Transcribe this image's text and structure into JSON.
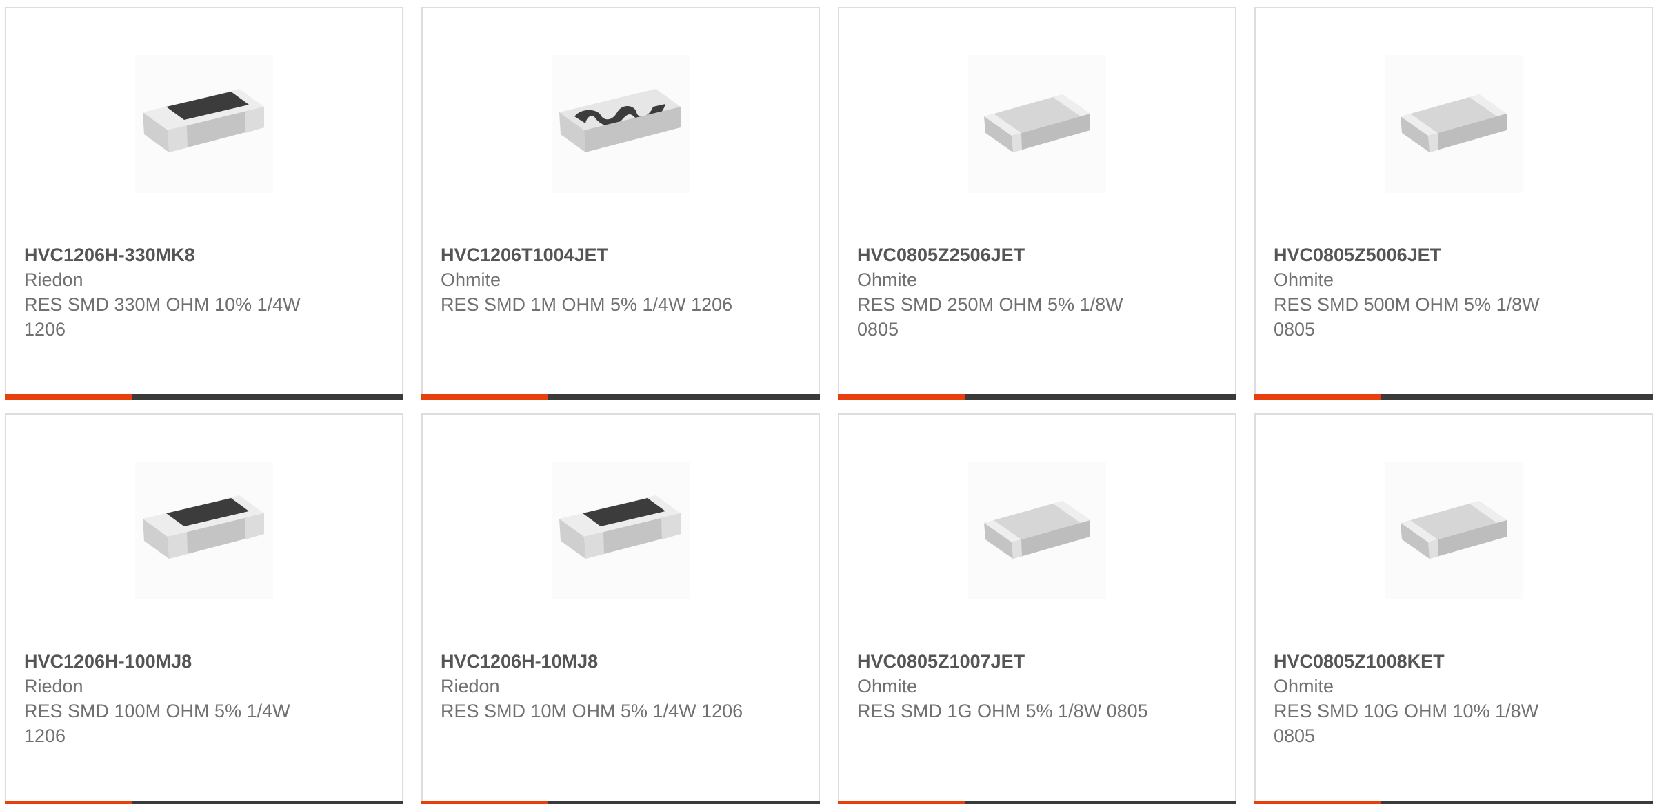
{
  "accent_color": "#e8400c",
  "bar_color": "#3a3a3a",
  "products": [
    {
      "part_number": "HVC1206H-330MK8",
      "manufacturer": "Riedon",
      "description": "RES SMD 330M OHM 10% 1/4W 1206",
      "image": "resistor-1206-dark-top-icon"
    },
    {
      "part_number": "HVC1206T1004JET",
      "manufacturer": "Ohmite",
      "description": "RES SMD 1M OHM 5% 1/4W 1206",
      "image": "resistor-1206-serpentine-icon"
    },
    {
      "part_number": "HVC0805Z2506JET",
      "manufacturer": "Ohmite",
      "description": "RES SMD 250M OHM 5% 1/8W 0805",
      "image": "resistor-0805-grey-icon"
    },
    {
      "part_number": "HVC0805Z5006JET",
      "manufacturer": "Ohmite",
      "description": "RES SMD 500M OHM 5% 1/8W 0805",
      "image": "resistor-0805-grey-icon"
    },
    {
      "part_number": "HVC1206H-100MJ8",
      "manufacturer": "Riedon",
      "description": "RES SMD 100M OHM 5% 1/4W 1206",
      "image": "resistor-1206-dark-top-icon"
    },
    {
      "part_number": "HVC1206H-10MJ8",
      "manufacturer": "Riedon",
      "description": "RES SMD 10M OHM 5% 1/4W 1206",
      "image": "resistor-1206-dark-top-icon"
    },
    {
      "part_number": "HVC0805Z1007JET",
      "manufacturer": "Ohmite",
      "description": "RES SMD 1G OHM 5% 1/8W 0805",
      "image": "resistor-0805-grey-icon"
    },
    {
      "part_number": "HVC0805Z1008KET",
      "manufacturer": "Ohmite",
      "description": "RES SMD 10G OHM 10% 1/8W 0805",
      "image": "resistor-0805-grey-icon"
    }
  ]
}
